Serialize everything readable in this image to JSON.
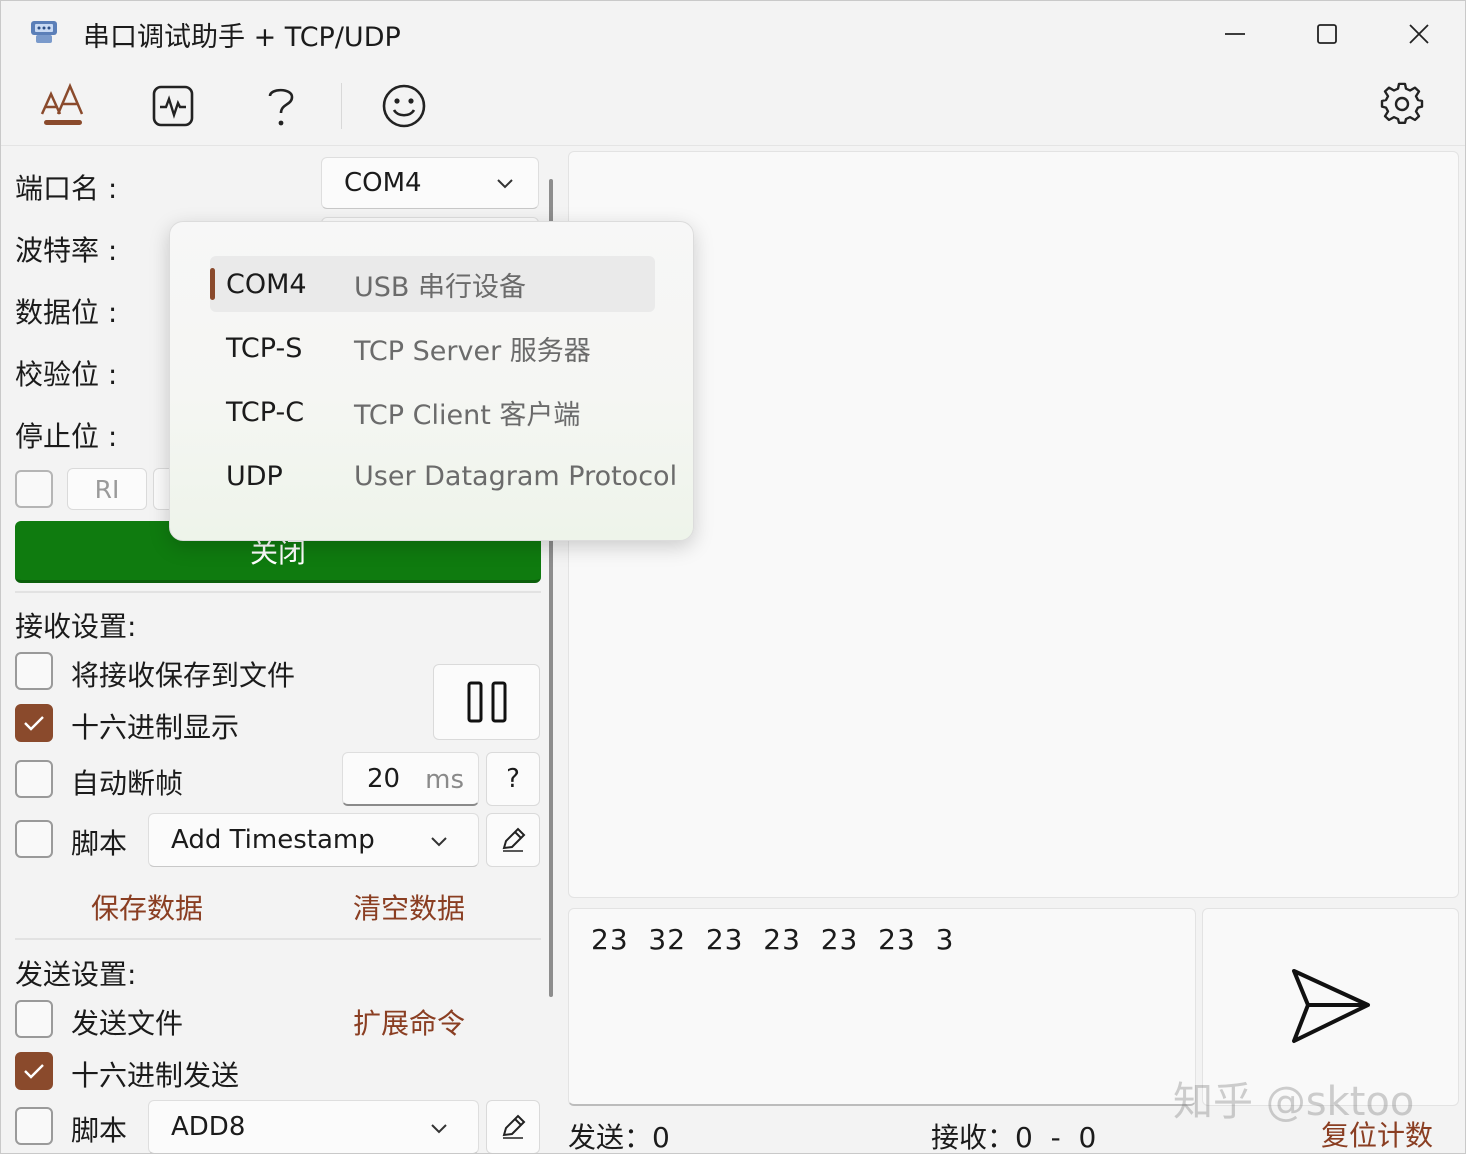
{
  "window": {
    "title": "串口调试助手 + TCP/UDP"
  },
  "left": {
    "port_label": "端口名 :",
    "baud_label": "波特率 :",
    "databits_label": "数据位 :",
    "parity_label": "校验位 :",
    "stopbits_label": "停止位 :",
    "port_value": "COM4",
    "ri_label": "RI",
    "close_button": "关闭",
    "recv_header": "接收设置:",
    "save_to_file": "将接收保存到文件",
    "hex_display": "十六进制显示",
    "auto_frame": "自动断帧",
    "frame_ms_value": "20",
    "frame_ms_unit": "ms",
    "help_glyph": "?",
    "script_label": "脚本",
    "recv_script_value": "Add Timestamp",
    "save_data": "保存数据",
    "clear_data": "清空数据",
    "send_header": "发送设置:",
    "send_file": "发送文件",
    "ext_cmd": "扩展命令",
    "hex_send": "十六进制发送",
    "send_script_label": "脚本",
    "send_script_value": "ADD8"
  },
  "popup": {
    "items": [
      {
        "key": "COM4",
        "desc": "USB 串行设备"
      },
      {
        "key": "TCP-S",
        "desc": "TCP Server 服务器"
      },
      {
        "key": "TCP-C",
        "desc": "TCP Client 客户端"
      },
      {
        "key": "UDP",
        "desc": "User Datagram Protocol"
      }
    ]
  },
  "right": {
    "send_text": "23  32  23  23  23  23  3",
    "sent_label": "发送：0",
    "recv_label": "接收：0  -  0",
    "reset_counter": "复位计数",
    "watermark": "知乎 @sktoo"
  },
  "toolbar": {
    "icons": [
      "font-icon",
      "waveform-icon",
      "help-icon",
      "smiley-icon",
      "gear-icon"
    ],
    "accent": "#8a4a2c"
  },
  "colors": {
    "accent": "#8a4a2c",
    "close_button": "#0f7b0f",
    "link": "#8a3e22"
  }
}
